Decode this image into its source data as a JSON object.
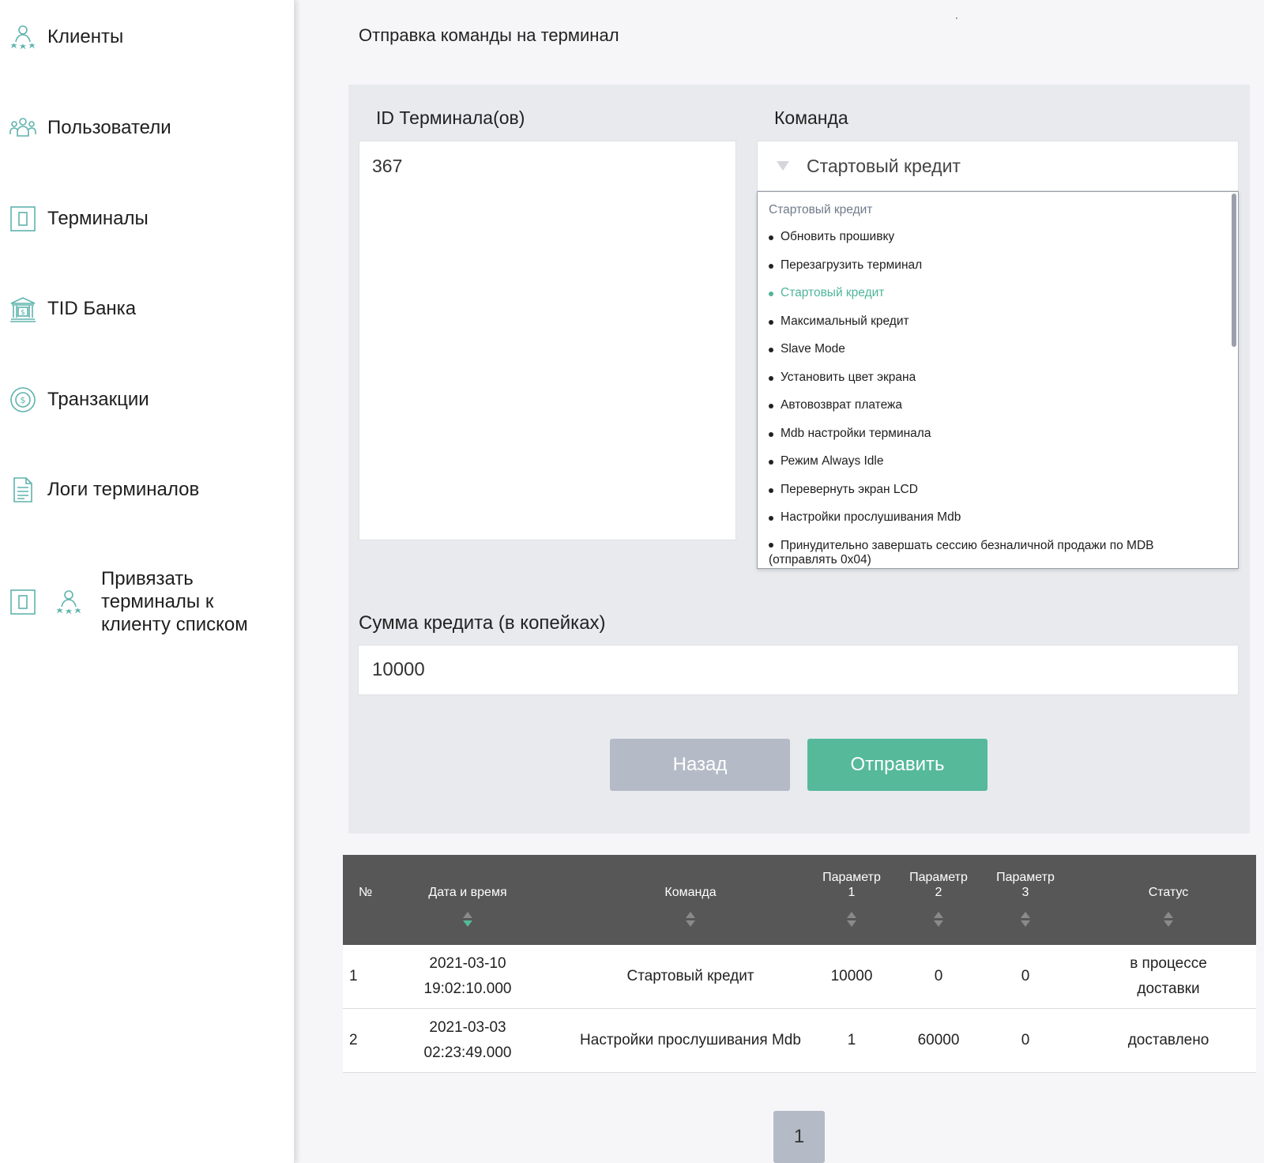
{
  "sidebar": {
    "items": [
      {
        "label": "Клиенты",
        "icon": "clients-icon"
      },
      {
        "label": "Пользователи",
        "icon": "users-icon"
      },
      {
        "label": "Терминалы",
        "icon": "terminal-icon"
      },
      {
        "label": "TID Банка",
        "icon": "bank-icon"
      },
      {
        "label": "Транзакции",
        "icon": "transactions-icon"
      },
      {
        "label": "Логи терминалов",
        "icon": "document-icon"
      },
      {
        "label": "Привязать терминалы к клиенту списком",
        "icon": "terminal-icon"
      }
    ]
  },
  "page": {
    "title": "Отправка команды на терминал"
  },
  "form": {
    "terminal_ids_label": "ID Терминала(ов)",
    "terminal_ids_value": "367",
    "command_label": "Команда",
    "command_selected": "Стартовый кредит",
    "dropdown_header": "Стартовый кредит",
    "dropdown_options": [
      "Обновить прошивку",
      "Перезагрузить терминал",
      "Стартовый кредит",
      "Максимальный кредит",
      "Slave Mode",
      "Установить цвет экрана",
      "Автовозврат платежа",
      "Mdb настройки терминала",
      "Режим Always Idle",
      "Перевернуть экран LCD",
      "Настройки прослушивания Mdb",
      "Принудительно завершать сессию безналичной продажи по MDB (отправлять 0x04)"
    ],
    "amount_label": "Сумма кредита (в копейках)",
    "amount_value": "10000",
    "back_button": "Назад",
    "send_button": "Отправить"
  },
  "table": {
    "headers": {
      "num": "№",
      "datetime": "Дата и время",
      "command": "Команда",
      "param1_line1": "Параметр",
      "param1_line2": "1",
      "param2_line1": "Параметр",
      "param2_line2": "2",
      "param3_line1": "Параметр",
      "param3_line2": "3",
      "status": "Статус"
    },
    "rows": [
      {
        "num": "1",
        "date": "2021-03-10",
        "time": "19:02:10.000",
        "command": "Стартовый кредит",
        "p1": "10000",
        "p2": "0",
        "p3": "0",
        "status_line1": "в процессе",
        "status_line2": "доставки"
      },
      {
        "num": "2",
        "date": "2021-03-03",
        "time": "02:23:49.000",
        "command": "Настройки прослушивания Mdb",
        "p1": "1",
        "p2": "60000",
        "p3": "0",
        "status_line1": "доставлено",
        "status_line2": ""
      }
    ]
  },
  "pagination": {
    "current": "1"
  },
  "colors": {
    "accent": "#55b99a",
    "icon": "#5fb3ad",
    "header_bg": "#575757",
    "disabled_button": "#b4bac6"
  }
}
